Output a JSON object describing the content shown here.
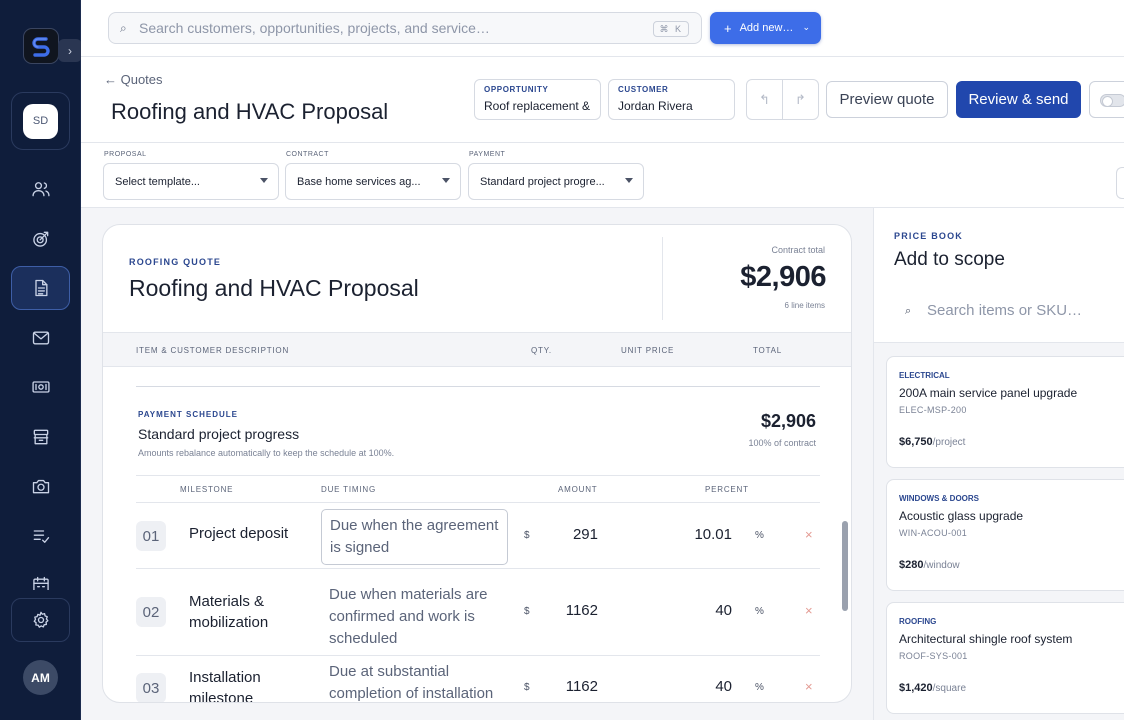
{
  "sidebar": {
    "logo_letter": "S",
    "expand_glyph": "›",
    "workspace_initials": "SD",
    "user_initials": "AM",
    "items": [
      {
        "icon": "users-icon"
      },
      {
        "icon": "target-icon"
      },
      {
        "icon": "document-icon",
        "active": true
      },
      {
        "icon": "mail-icon"
      },
      {
        "icon": "cash-icon"
      },
      {
        "icon": "archive-icon"
      },
      {
        "icon": "camera-icon"
      },
      {
        "icon": "checklist-icon"
      },
      {
        "icon": "calendar-icon"
      },
      {
        "icon": "gear-icon"
      }
    ]
  },
  "topbar": {
    "search_placeholder": "Search customers, opportunities, projects, and service…",
    "shortcut": "⌘ K",
    "add_button": "Add new…"
  },
  "header": {
    "breadcrumb": "← Quotes",
    "title": "Roofing and HVAC Proposal",
    "opportunity": {
      "label": "OPPORTUNITY",
      "value": "Roof replacement &"
    },
    "customer": {
      "label": "CUSTOMER",
      "value": "Jordan Rivera"
    },
    "preview_button": "Preview quote",
    "review_button": "Review & send"
  },
  "templates": {
    "proposal": {
      "label": "PROPOSAL",
      "value": "Select template..."
    },
    "contract": {
      "label": "CONTRACT",
      "value": "Base home services ag..."
    },
    "payment": {
      "label": "PAYMENT",
      "value": "Standard project progre..."
    }
  },
  "quote": {
    "kicker": "ROOFING QUOTE",
    "title": "Roofing and HVAC Proposal",
    "total_label": "Contract total",
    "total": "$2,906",
    "line_items": "6 line items",
    "columns": [
      "ITEM & CUSTOMER DESCRIPTION",
      "QTY.",
      "UNIT PRICE",
      "TOTAL"
    ]
  },
  "payment_schedule": {
    "kicker": "PAYMENT SCHEDULE",
    "title": "Standard project progress",
    "note": "Amounts rebalance automatically to keep the schedule at 100%.",
    "amount": "$2,906",
    "percent_of_contract": "100% of contract",
    "columns": [
      "MILESTONE",
      "DUE TIMING",
      "AMOUNT",
      "PERCENT"
    ],
    "rows": [
      {
        "num": "01",
        "name": "Project deposit",
        "due": "Due when the agreement is signed",
        "currency": "$",
        "amount": "291",
        "percent": "10.01",
        "pct_symbol": "%",
        "remove": "×"
      },
      {
        "num": "02",
        "name": "Materials & mobilization",
        "due": "Due when materials are confirmed and work is scheduled",
        "currency": "$",
        "amount": "1162",
        "percent": "40",
        "pct_symbol": "%",
        "remove": "×"
      },
      {
        "num": "03",
        "name": "Installation milestone",
        "due": "Due at substantial completion of installation",
        "currency": "$",
        "amount": "1162",
        "percent": "40",
        "pct_symbol": "%",
        "remove": "×"
      }
    ]
  },
  "price_book": {
    "kicker": "PRICE BOOK",
    "title": "Add to scope",
    "search_placeholder": "Search items or SKU…",
    "items": [
      {
        "category": "ELECTRICAL",
        "name": "200A main service panel upgrade",
        "sku": "ELEC-MSP-200",
        "price": "$6,750",
        "unit": "/project"
      },
      {
        "category": "WINDOWS & DOORS",
        "name": "Acoustic glass upgrade",
        "sku": "WIN-ACOU-001",
        "price": "$280",
        "unit": "/window"
      },
      {
        "category": "ROOFING",
        "name": "Architectural shingle roof system",
        "sku": "ROOF-SYS-001",
        "price": "$1,420",
        "unit": "/square"
      }
    ]
  },
  "colors": {
    "sidebar": "#0f1d3b",
    "primary": "#2147ad",
    "accent": "#3d6de8",
    "danger": "#e39a92"
  }
}
